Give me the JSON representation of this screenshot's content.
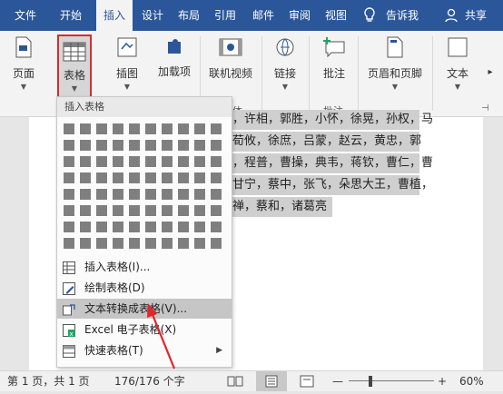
{
  "tabs": [
    "文件",
    "开始",
    "插入",
    "设计",
    "布局",
    "引用",
    "邮件",
    "审阅",
    "视图",
    "告诉我",
    "共享"
  ],
  "ribbon": {
    "buttons": [
      "页面",
      "表格",
      "插图",
      "加载项",
      "联机视频",
      "链接",
      "批注",
      "页眉和页脚",
      "文本"
    ],
    "groups": [
      "体",
      "批注"
    ]
  },
  "menu": {
    "title": "插入表格",
    "items": [
      "插入表格(I)...",
      "绘制表格(D)",
      "文本转换成表格(V)...",
      "Excel 电子表格(X)",
      "快速表格(T)"
    ]
  },
  "document": {
    "lines": [
      "，许相，郭胜，小怀，徐晃，孙权，马",
      "荀攸，徐庶，吕蒙，赵云，黄忠，郭",
      "，程普，曹操，典韦，蒋钦，曹仁，曹",
      "甘宁，蔡中，张飞，朵思大王，曹植，",
      "禅，蔡和，诸葛亮"
    ]
  },
  "status": {
    "page": "第 1 页，共 1 页",
    "words": "176/176 个字",
    "zoom_minus": "—",
    "zoom_plus": "+",
    "zoom": "60%"
  },
  "colors": {
    "accent": "#2b579a",
    "highlight_box": "#e0262b",
    "arrow": "#e0262b"
  }
}
